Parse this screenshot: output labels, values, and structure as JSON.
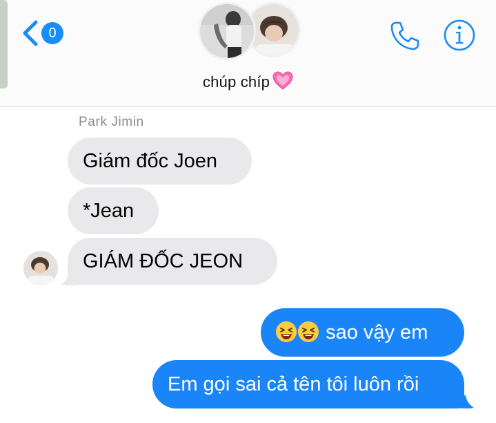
{
  "header": {
    "back_badge": "0",
    "group_name": "chúp chíp",
    "colors": {
      "accent": "#1a8cf5",
      "header_bg": "#fbfbfb"
    },
    "icons": {
      "back": "chevron-left-icon",
      "call": "phone-icon",
      "details": "info-icon",
      "heart": "pink-heart-emoji"
    }
  },
  "conversation": {
    "sender_name": "Park Jimin",
    "incoming": [
      {
        "text": "Giám đốc Joen"
      },
      {
        "text": "*Jean"
      },
      {
        "text": "GIÁM ĐỐC JEON"
      }
    ],
    "outgoing": [
      {
        "emoji": "laughing-emoji",
        "emoji_count": 2,
        "text": "sao vậy em"
      },
      {
        "text": "Em gọi sai cả tên tôi luôn rồi"
      }
    ],
    "colors": {
      "incoming_bubble": "#e9e9eb",
      "outgoing_bubble": "#1a85f8"
    }
  }
}
